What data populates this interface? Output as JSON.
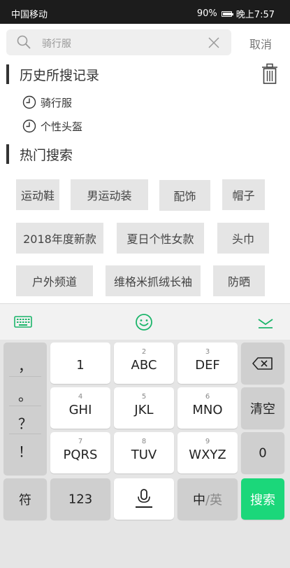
{
  "status_bar": {
    "carrier": "中国移动",
    "battery": "90%",
    "battery_level": 0.9,
    "time": "晚上7:57"
  },
  "search": {
    "value": "骑行服",
    "cancel_label": "取消"
  },
  "history": {
    "title": "历史所搜记录",
    "items": [
      {
        "label": "骑行服"
      },
      {
        "label": "个性头盔"
      }
    ]
  },
  "hot": {
    "title": "热门搜索",
    "tags": [
      {
        "label": "运动鞋"
      },
      {
        "label": "男运动装"
      },
      {
        "label": "配饰"
      },
      {
        "label": "帽子"
      },
      {
        "label": "2018年度新款"
      },
      {
        "label": "夏日个性女款"
      },
      {
        "label": "头巾"
      },
      {
        "label": "户外频道"
      },
      {
        "label": "维格米抓绒长袖"
      },
      {
        "label": "防晒"
      }
    ]
  },
  "keyboard": {
    "toolbar": {
      "left_icon": "keyboard-icon",
      "center_icon": "emoji-icon",
      "right_icon": "collapse-icon",
      "accent_color": "#1bb56a"
    },
    "punctuation": [
      "，",
      "。",
      "？",
      "！"
    ],
    "keys": [
      {
        "num": "",
        "label": "1"
      },
      {
        "num": "2",
        "label": "ABC"
      },
      {
        "num": "3",
        "label": "DEF"
      },
      {
        "num": "4",
        "label": "GHI"
      },
      {
        "num": "5",
        "label": "JKL"
      },
      {
        "num": "6",
        "label": "MNO"
      },
      {
        "num": "7",
        "label": "PQRS"
      },
      {
        "num": "8",
        "label": "TUV"
      },
      {
        "num": "9",
        "label": "WXYZ"
      }
    ],
    "clear_label": "清空",
    "zero_label": "0",
    "symbol_label": "符",
    "num_label": "123",
    "lang_zh": "中",
    "lang_sep": "/",
    "lang_en": "英",
    "search_label": "搜索",
    "search_color": "#1bd77a"
  }
}
